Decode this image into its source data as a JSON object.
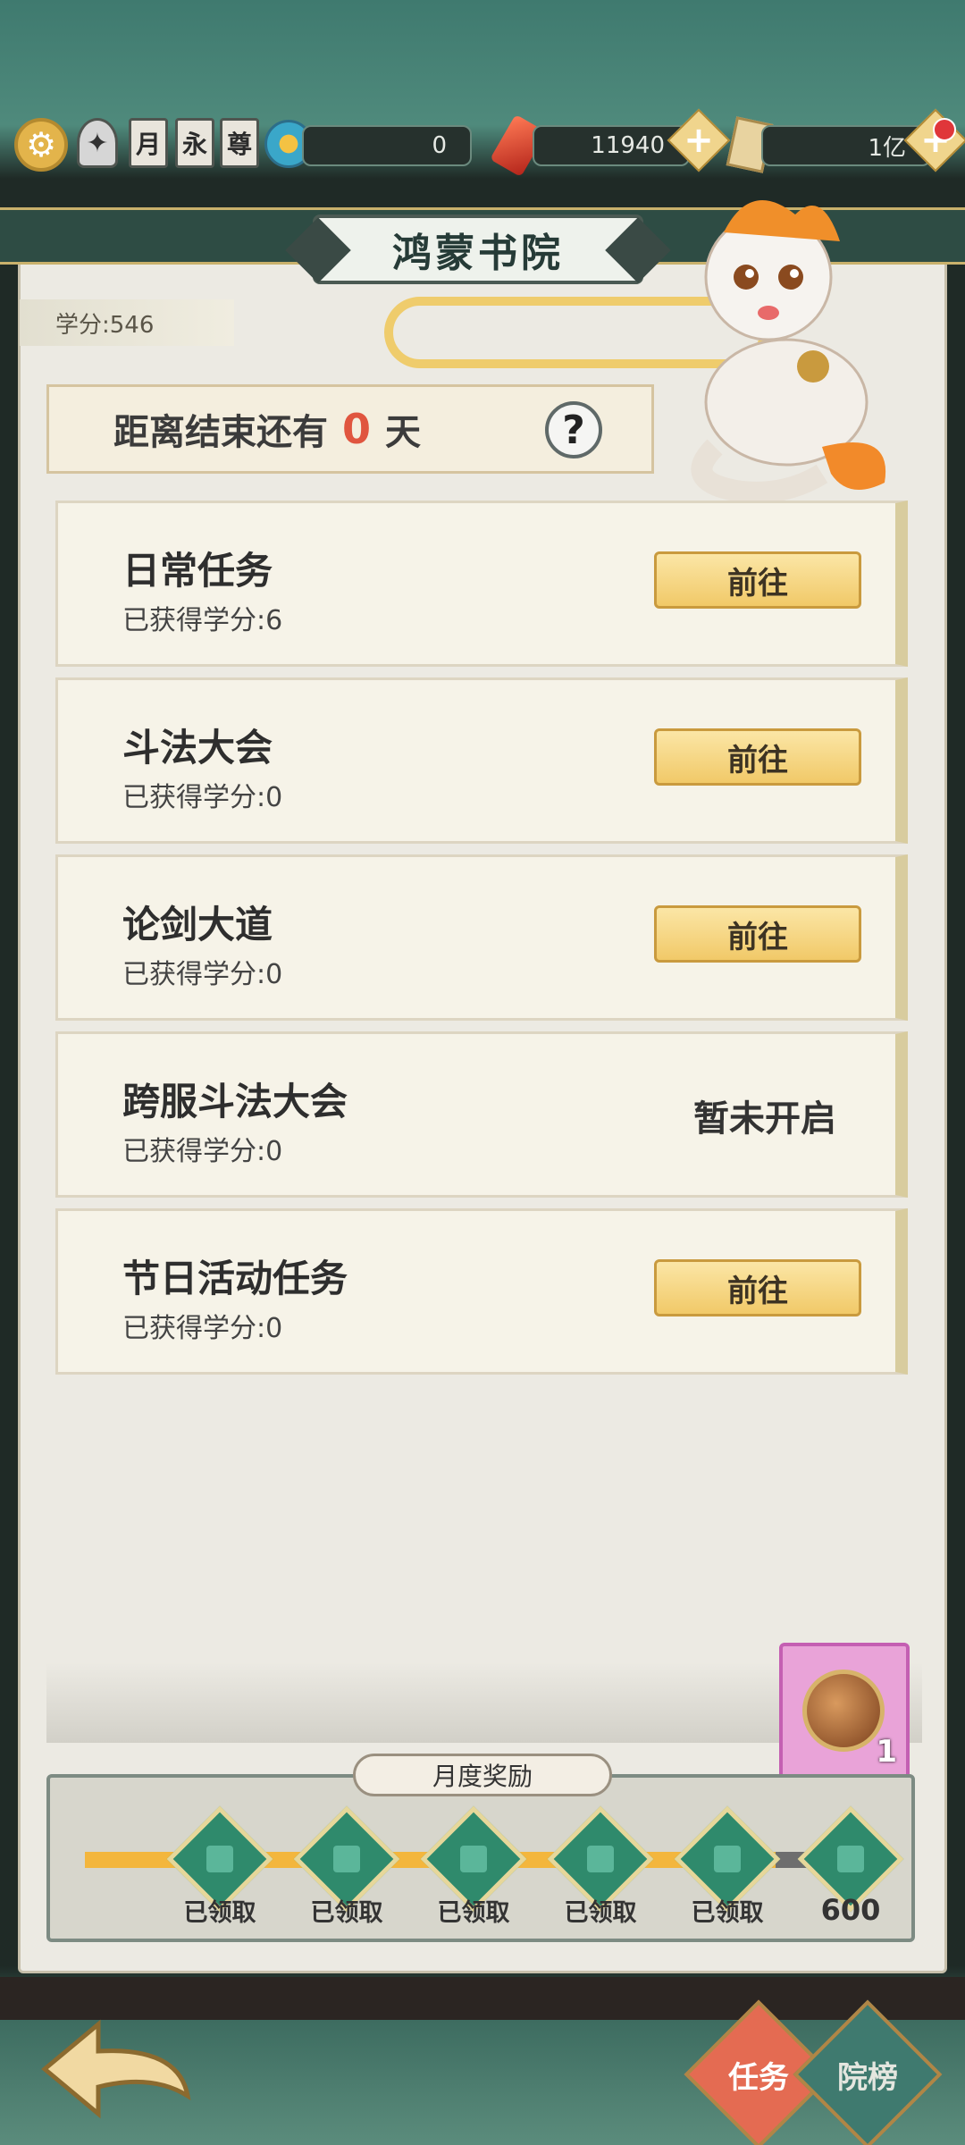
{
  "topbar": {
    "badges": [
      "月",
      "永",
      "尊"
    ],
    "vip_value": "0",
    "gems": "11940",
    "currency": "1亿"
  },
  "colors": {
    "accent_gold": "#f1c968",
    "countdown_red": "#e0553f",
    "tab_active": "#e46b52",
    "tab_inactive": "#3f7a6f"
  },
  "title": "鸿蒙书院",
  "points_label": "学分:546",
  "countdown": {
    "prefix": "距离结束还有",
    "value": "0",
    "suffix": "天"
  },
  "help": "?",
  "tasks": [
    {
      "name": "日常任务",
      "earned": "已获得学分:6",
      "action": "前往"
    },
    {
      "name": "斗法大会",
      "earned": "已获得学分:0",
      "action": "前往"
    },
    {
      "name": "论剑大道",
      "earned": "已获得学分:0",
      "action": "前往"
    },
    {
      "name": "跨服斗法大会",
      "earned": "已获得学分:0",
      "status": "暂未开启"
    },
    {
      "name": "节日活动任务",
      "earned": "已获得学分:0",
      "action": "前往"
    }
  ],
  "monthly": {
    "title": "月度奖励",
    "chest_count": "1",
    "nodes": [
      "已领取",
      "已领取",
      "已领取",
      "已领取",
      "已领取",
      "600"
    ]
  },
  "tabs": {
    "task": "任务",
    "rank": "院榜"
  }
}
